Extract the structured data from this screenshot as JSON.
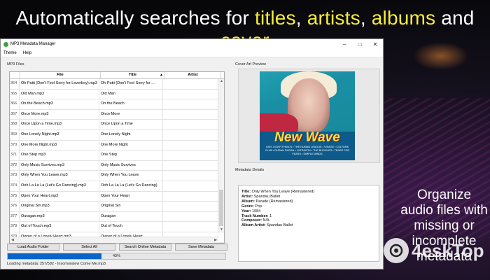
{
  "promo": {
    "headline_pre": "Automatically searches for ",
    "headline_titles": "titles",
    "headline_sep1": ", ",
    "headline_artists": "artists",
    "headline_sep2": ", ",
    "headline_albums": "albums",
    "headline_and": " and ",
    "headline_cover": "cover",
    "side_text": "Organize audio files with missing or incomplete metadata",
    "watermark": "4eskTop"
  },
  "window": {
    "title": "MP3 Metadata Manager",
    "menu": [
      "Theme",
      "Help"
    ]
  },
  "files_panel": {
    "label": "MP3 Files",
    "columns": {
      "index": "",
      "file": "File",
      "title": "Title",
      "artist": "Artist"
    },
    "rows": [
      {
        "index": "364",
        "file": "Oh Patti (Don't Feel Sorry for Loverboy).mp3",
        "title": "Oh Patti (Don't Feel Sorry for ...",
        "artist": ""
      },
      {
        "index": "365",
        "file": "Old Man.mp3",
        "title": "Old Man",
        "artist": ""
      },
      {
        "index": "366",
        "file": "On the Beach.mp3",
        "title": "On the Beach",
        "artist": ""
      },
      {
        "index": "367",
        "file": "Once More.mp3",
        "title": "Once More",
        "artist": ""
      },
      {
        "index": "368",
        "file": "Once Upon a Time.mp3",
        "title": "Once Upon a Time",
        "artist": ""
      },
      {
        "index": "369",
        "file": "One Lonely Night.mp3",
        "title": "One Lonely Night",
        "artist": ""
      },
      {
        "index": "370",
        "file": "One More Night.mp3",
        "title": "One More Night",
        "artist": ""
      },
      {
        "index": "371",
        "file": "One Step.mp3",
        "title": "One Step",
        "artist": ""
      },
      {
        "index": "372",
        "file": "Only Music Survives.mp3",
        "title": "Only Music Survives",
        "artist": ""
      },
      {
        "index": "373",
        "file": "Only When You Leave.mp3",
        "title": "Only When You Leave",
        "artist": ""
      },
      {
        "index": "374",
        "file": "Ooh La La La (Let's Go Dancing).mp3",
        "title": "Ooh La La La (Let's Go Dancing)",
        "artist": ""
      },
      {
        "index": "375",
        "file": "Open Your Heart.mp3",
        "title": "Open Your Heart",
        "artist": ""
      },
      {
        "index": "376",
        "file": "Original Sin.mp3",
        "title": "Original Sin",
        "artist": ""
      },
      {
        "index": "377",
        "file": "Ouragan.mp3",
        "title": "Ouragan",
        "artist": ""
      },
      {
        "index": "378",
        "file": "Out of Touch.mp3",
        "title": "Out of Touch",
        "artist": ""
      },
      {
        "index": "379",
        "file": "Owner of a Lonely Heart.mp3",
        "title": "Owner of a Lonely Heart",
        "artist": ""
      }
    ]
  },
  "buttons": {
    "load": "Load Audio Folder",
    "select_all": "Select All",
    "search_online": "Search Online Metadata",
    "save": "Save Metadata"
  },
  "progress": {
    "value": 0.43,
    "text": "43%"
  },
  "status_text": "Loading metadata: 257/592 - Insomoratevi Come Me.mp3",
  "cover_panel": {
    "label": "Cover Art Preview",
    "art_title": "New Wave",
    "art_subtitle": "INXS • EURYTHMICS • THE HUMAN LEAGUE • VISAGE • CULTURE CLUB • DURAN DURAN • ULTRAVOX • THE BUGGLES • TEARS FOR FEARS • SIMPLE MINDS"
  },
  "details_panel": {
    "label": "Metadata Details",
    "fields": [
      {
        "key": "Title:",
        "value": " Only When You Leave (Remastered)"
      },
      {
        "key": "Artist:",
        "value": " Spandau Ballet"
      },
      {
        "key": "Album:",
        "value": " Parade (Remastered)"
      },
      {
        "key": "Genre:",
        "value": " Pop"
      },
      {
        "key": "Year:",
        "value": " 1984"
      },
      {
        "key": "Track Number:",
        "value": " 1"
      },
      {
        "key": "Composer:",
        "value": " N/A"
      },
      {
        "key": "Album Artist:",
        "value": " Spandau Ballet"
      }
    ]
  },
  "colors": {
    "accent": "#0a64c8",
    "highlight": "#f6ec3b"
  }
}
